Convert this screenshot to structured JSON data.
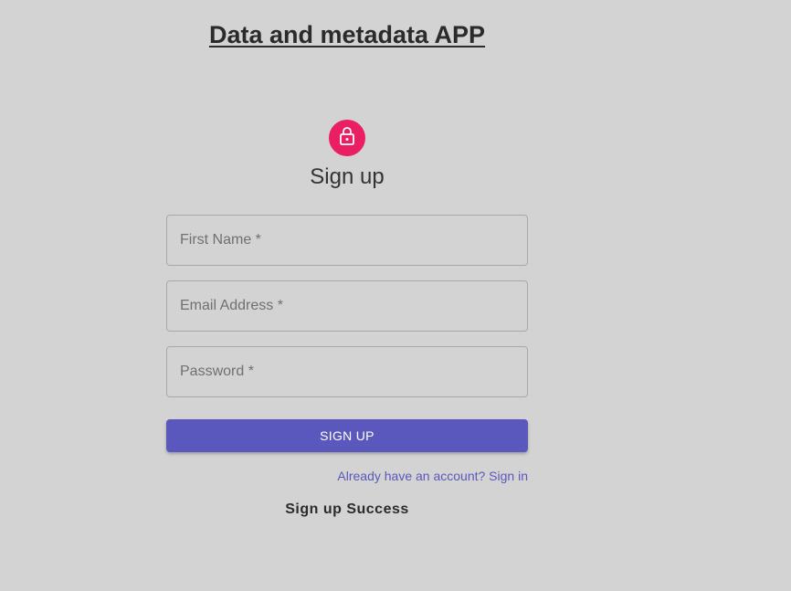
{
  "app": {
    "title": "Data and metadata APP"
  },
  "form": {
    "icon": "lock-open-icon",
    "icon_bg_color": "#e91e63",
    "heading": "Sign up",
    "fields": {
      "first_name": {
        "placeholder": "First Name *",
        "value": ""
      },
      "email": {
        "placeholder": "Email Address *",
        "value": ""
      },
      "password": {
        "placeholder": "Password *",
        "value": ""
      }
    },
    "submit_label": "SIGN UP",
    "submit_color": "#5a58bc",
    "signin_link": "Already have an account? Sign in",
    "status_message": "Sign up Success"
  }
}
